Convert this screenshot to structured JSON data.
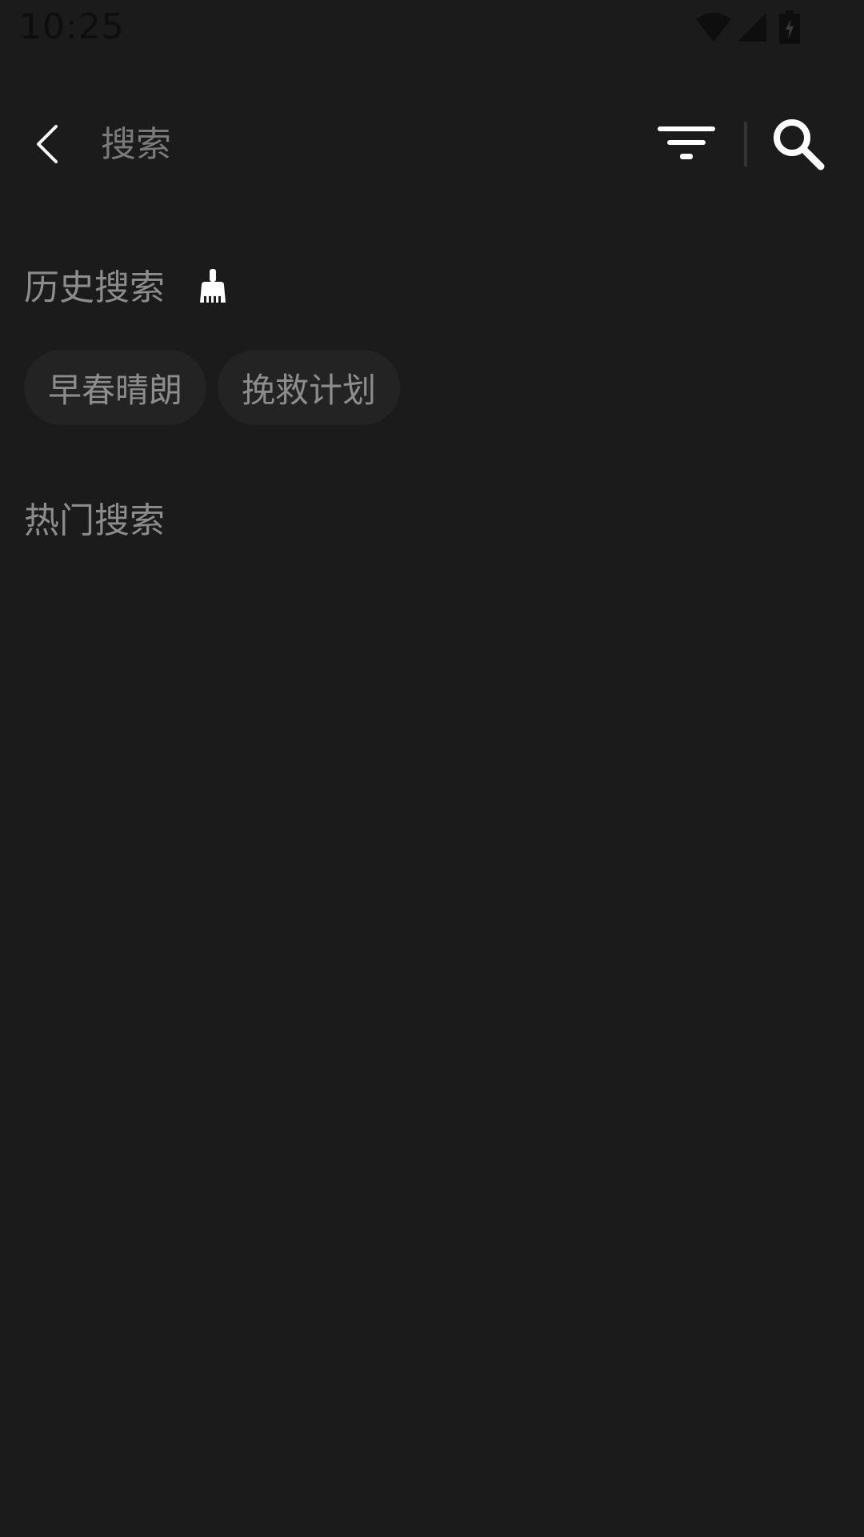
{
  "status_bar": {
    "time": "10:25",
    "icons": [
      "wifi-icon",
      "cellular-signal-icon",
      "battery-charging-icon"
    ]
  },
  "top_bar": {
    "back_icon": "chevron-left-icon",
    "search_placeholder": "搜索",
    "search_value": "",
    "filter_icon": "filter-icon",
    "search_icon": "search-icon"
  },
  "history": {
    "title": "历史搜索",
    "clear_icon": "broom-icon",
    "items": [
      "早春晴朗",
      "挽救计划"
    ]
  },
  "hot": {
    "title": "热门搜索"
  },
  "colors": {
    "background": "#1b1b1b",
    "chip_background": "#232323",
    "text_secondary": "#8c8c8c",
    "icon": "#ffffff"
  }
}
